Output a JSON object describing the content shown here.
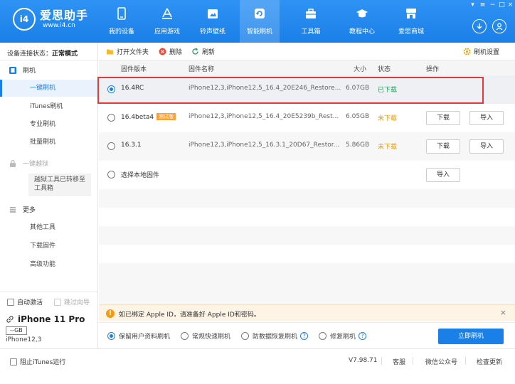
{
  "app": {
    "name": "爱思助手",
    "url": "www.i4.cn",
    "logo_text": "i4",
    "colors": {
      "brand": "#1B7FE8",
      "downloaded": "#1AA35B",
      "not_downloaded": "#F09A00",
      "highlight": "#E03B3B",
      "notice_icon": "#F39C12"
    }
  },
  "nav": {
    "items": [
      {
        "label": "我的设备",
        "icon": "phone-icon"
      },
      {
        "label": "应用游戏",
        "icon": "apps-icon"
      },
      {
        "label": "铃声壁纸",
        "icon": "wallpaper-icon"
      },
      {
        "label": "智能刷机",
        "icon": "flash-icon",
        "active": true
      },
      {
        "label": "工具箱",
        "icon": "toolbox-icon"
      },
      {
        "label": "教程中心",
        "icon": "graduation-cap-icon"
      },
      {
        "label": "爱思商城",
        "icon": "shop-icon"
      }
    ],
    "window_controls": [
      "▾",
      "≡",
      "−",
      "□",
      "×"
    ]
  },
  "sidebar": {
    "status_label": "设备连接状态：",
    "status_value": "正常模式",
    "flash_header": "刷机",
    "flash_items": [
      "一键刷机",
      "iTunes刷机",
      "专业刷机",
      "批量刷机"
    ],
    "jailbreak_header": "一键越狱",
    "jailbreak_note": "越狱工具已转移至工具箱",
    "more_header": "更多",
    "more_items": [
      "其他工具",
      "下载固件",
      "高级功能"
    ],
    "auto_activate": "自动激活",
    "skip_wizard": "跳过向导",
    "device_name": "iPhone 11 Pro",
    "device_capacity": "--GB",
    "device_model": "iPhone12,3"
  },
  "toolbar": {
    "open_folder": "打开文件夹",
    "delete": "删除",
    "refresh": "刷新",
    "flash_settings": "刷机设置"
  },
  "table": {
    "headers": {
      "version": "固件版本",
      "name": "固件名称",
      "size": "大小",
      "status": "状态",
      "action": "操作"
    },
    "rows": [
      {
        "version": "16.4RC",
        "name": "iPhone12,3,iPhone12,5_16.4_20E246_Restore...",
        "size": "6.07GB",
        "status": "已下载",
        "selected": true
      },
      {
        "version": "16.4beta4",
        "tag": "测试版",
        "name": "iPhone12,3,iPhone12,5_16.4_20E5239b_Rest...",
        "size": "6.05GB",
        "status": "未下载",
        "download": "下载",
        "import": "导入"
      },
      {
        "version": "16.3.1",
        "name": "iPhone12,3,iPhone12,5_16.3.1_20D67_Restor...",
        "size": "5.86GB",
        "status": "未下载",
        "download": "下载",
        "import": "导入"
      },
      {
        "version": "选择本地固件",
        "import": "导入"
      }
    ]
  },
  "notice": {
    "text": "如已绑定 Apple ID，请准备好 Apple ID和密码。",
    "close": "×"
  },
  "modes": {
    "options": [
      "保留用户资料刷机",
      "常规快速刷机",
      "防数据恢复刷机",
      "修复刷机"
    ],
    "help": "?",
    "primary": "立即刷机"
  },
  "statusbar": {
    "block_itunes": "阻止iTunes运行",
    "version": "V7.98.71",
    "feedback": "客服",
    "wechat": "微信公众号",
    "check_update": "检查更新"
  }
}
